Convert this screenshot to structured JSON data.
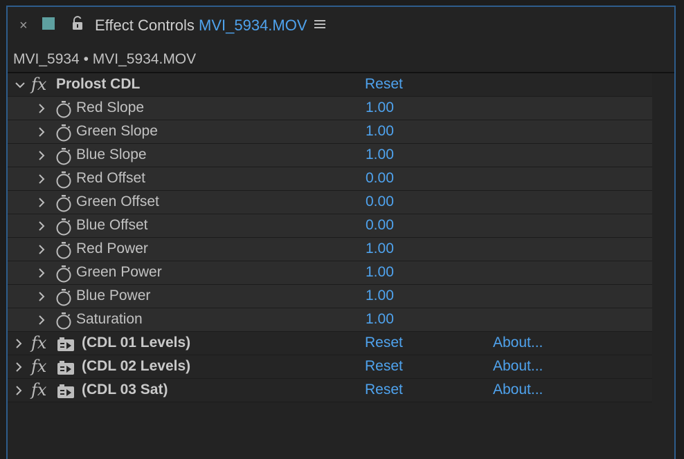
{
  "tab": {
    "close_glyph": "×",
    "swatch_color": "#5ea0a0",
    "title_prefix": "Effect Controls",
    "title_clip": "MVI_5934.MOV",
    "menu_icon": "hamburger-menu-icon",
    "lock_icon": "unlock-icon"
  },
  "subtitle": "MVI_5934 • MVI_5934.MOV",
  "effects": [
    {
      "name": "Prolost CDL",
      "reset_label": "Reset",
      "expanded": true,
      "params": [
        {
          "name": "Red Slope",
          "value": "1.00"
        },
        {
          "name": "Green Slope",
          "value": "1.00"
        },
        {
          "name": "Blue Slope",
          "value": "1.00"
        },
        {
          "name": "Red Offset",
          "value": "0.00"
        },
        {
          "name": "Green Offset",
          "value": "0.00"
        },
        {
          "name": "Blue Offset",
          "value": "0.00"
        },
        {
          "name": "Red Power",
          "value": "1.00"
        },
        {
          "name": "Green Power",
          "value": "1.00"
        },
        {
          "name": "Blue Power",
          "value": "1.00"
        },
        {
          "name": "Saturation",
          "value": "1.00"
        }
      ]
    },
    {
      "name": "(CDL 01 Levels)",
      "reset_label": "Reset",
      "about_label": "About..."
    },
    {
      "name": "(CDL 02 Levels)",
      "reset_label": "Reset",
      "about_label": "About..."
    },
    {
      "name": "(CDL 03 Sat)",
      "reset_label": "Reset",
      "about_label": "About..."
    }
  ],
  "accent_color": "#4fa3ee",
  "fx_glyph": "fx"
}
